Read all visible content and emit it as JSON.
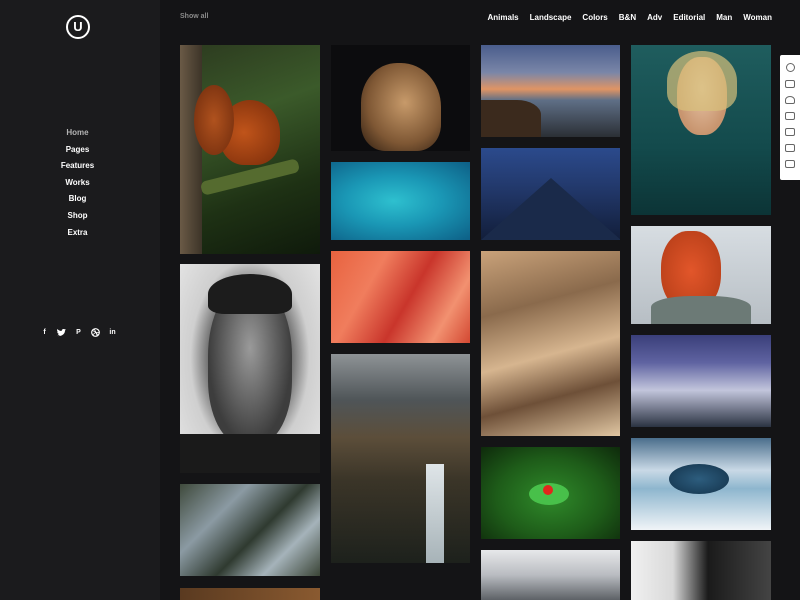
{
  "logo": {
    "letter": "U"
  },
  "nav": [
    "Home",
    "Pages",
    "Features",
    "Works",
    "Blog",
    "Shop",
    "Extra"
  ],
  "social_icons": [
    "facebook-icon",
    "twitter-icon",
    "pinterest-icon",
    "dribbble-icon",
    "linkedin-icon"
  ],
  "filters": {
    "show_all": "Show all",
    "items": [
      "Animals",
      "Landscape",
      "Colors",
      "B&N",
      "Adv",
      "Editorial",
      "Man",
      "Woman"
    ]
  },
  "gallery": [
    "squirrel",
    "dog",
    "coast-sunset",
    "woman-in-water",
    "man-portrait-bw",
    "reef-aerial",
    "mountain-ridge",
    "red-haired-woman",
    "flamingos",
    "sand-dunes",
    "snowy-valley",
    "river-aerial",
    "waterfall",
    "frog",
    "frozen-crater",
    "mountain-lake",
    "woman-portrait"
  ],
  "right_toolbar": [
    "settings-icon",
    "comment-icon",
    "heart-icon",
    "monitor-icon",
    "layout-icon",
    "book-icon",
    "video-icon"
  ]
}
